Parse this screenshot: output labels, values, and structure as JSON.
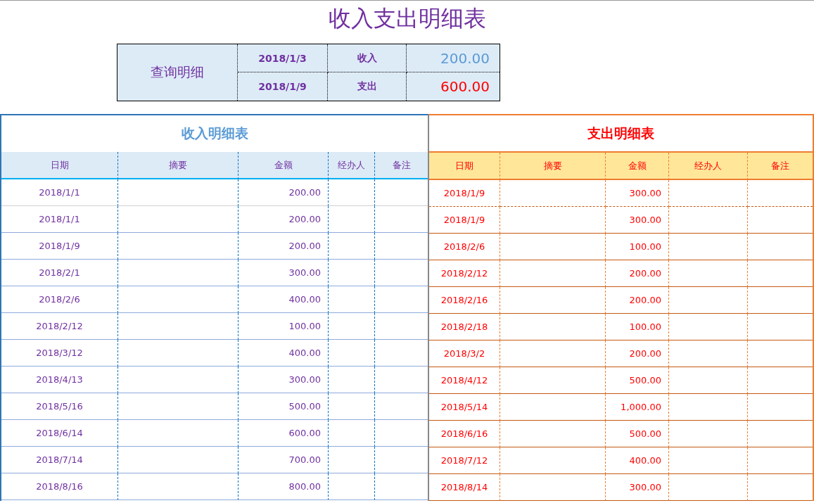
{
  "title": "收入支出明细表",
  "query": {
    "label": "查询明细",
    "rows": [
      {
        "date": "2018/1/3",
        "type": "收入",
        "kind": "income",
        "amount": "200.00"
      },
      {
        "date": "2018/1/9",
        "type": "支出",
        "kind": "expense",
        "amount": "600.00"
      }
    ]
  },
  "tables": [
    {
      "kind": "income",
      "title": "收入明细表",
      "columns": [
        "日期",
        "摘要",
        "金额",
        "经办人",
        "备注"
      ],
      "rows": [
        {
          "date": "2018/1/1",
          "amount": "200.00"
        },
        {
          "date": "2018/1/1",
          "amount": "200.00"
        },
        {
          "date": "2018/1/9",
          "amount": "200.00"
        },
        {
          "date": "2018/2/1",
          "amount": "300.00"
        },
        {
          "date": "2018/2/6",
          "amount": "400.00"
        },
        {
          "date": "2018/2/12",
          "amount": "100.00"
        },
        {
          "date": "2018/3/12",
          "amount": "400.00"
        },
        {
          "date": "2018/4/13",
          "amount": "300.00"
        },
        {
          "date": "2018/5/16",
          "amount": "500.00"
        },
        {
          "date": "2018/6/14",
          "amount": "600.00"
        },
        {
          "date": "2018/7/14",
          "amount": "700.00"
        },
        {
          "date": "2018/8/16",
          "amount": "800.00"
        }
      ]
    },
    {
      "kind": "expense",
      "title": "支出明细表",
      "columns": [
        "日期",
        "摘要",
        "金额",
        "经办人",
        "备注"
      ],
      "rows": [
        {
          "date": "2018/1/9",
          "amount": "300.00"
        },
        {
          "date": "2018/1/9",
          "amount": "300.00"
        },
        {
          "date": "2018/2/6",
          "amount": "100.00"
        },
        {
          "date": "2018/2/12",
          "amount": "200.00"
        },
        {
          "date": "2018/2/16",
          "amount": "200.00"
        },
        {
          "date": "2018/2/18",
          "amount": "100.00"
        },
        {
          "date": "2018/3/2",
          "amount": "200.00"
        },
        {
          "date": "2018/4/12",
          "amount": "500.00"
        },
        {
          "date": "2018/5/14",
          "amount": "1,000.00"
        },
        {
          "date": "2018/6/16",
          "amount": "500.00"
        },
        {
          "date": "2018/7/12",
          "amount": "400.00"
        },
        {
          "date": "2018/8/14",
          "amount": "300.00"
        }
      ]
    }
  ]
}
